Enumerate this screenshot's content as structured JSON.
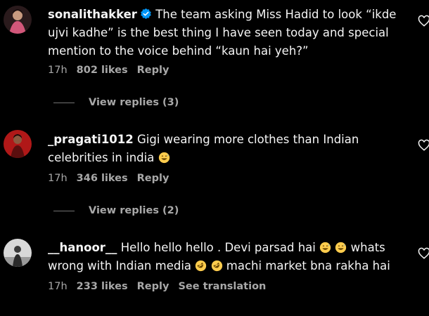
{
  "comments": [
    {
      "username": "sonalithakker",
      "verified": true,
      "text": "The team asking Miss Hadid to look “ikde ujvi kadhe” is the best thing I have seen today and special mention to the voice behind “kaun hai yeh?”",
      "time": "17h",
      "likes": "802 likes",
      "reply": "Reply",
      "view_replies": "View replies (3)"
    },
    {
      "username": "_pragati1012",
      "text_before_emoji": "Gigi wearing more clothes than Indian celebrities in india",
      "emoji": "grinning-sweat",
      "time": "17h",
      "likes": "346 likes",
      "reply": "Reply",
      "view_replies": "View replies (2)"
    },
    {
      "username": "__hanoor__",
      "text_part1": "Hello hello hello . Devi parsad hai",
      "text_part2": "whats wrong with Indian media",
      "text_part3": "machi market bna rakha hai",
      "emojis_1": [
        "grinning-sweat",
        "grinning-sweat"
      ],
      "emojis_2": [
        "rolling-laughing",
        "rolling-laughing"
      ],
      "time": "17h",
      "likes": "233 likes",
      "reply": "Reply",
      "see_translation": "See translation"
    }
  ],
  "colors": {
    "background": "#000000",
    "text": "#f5f5f5",
    "meta": "#a8a8a8",
    "verified": "#0095f6"
  }
}
